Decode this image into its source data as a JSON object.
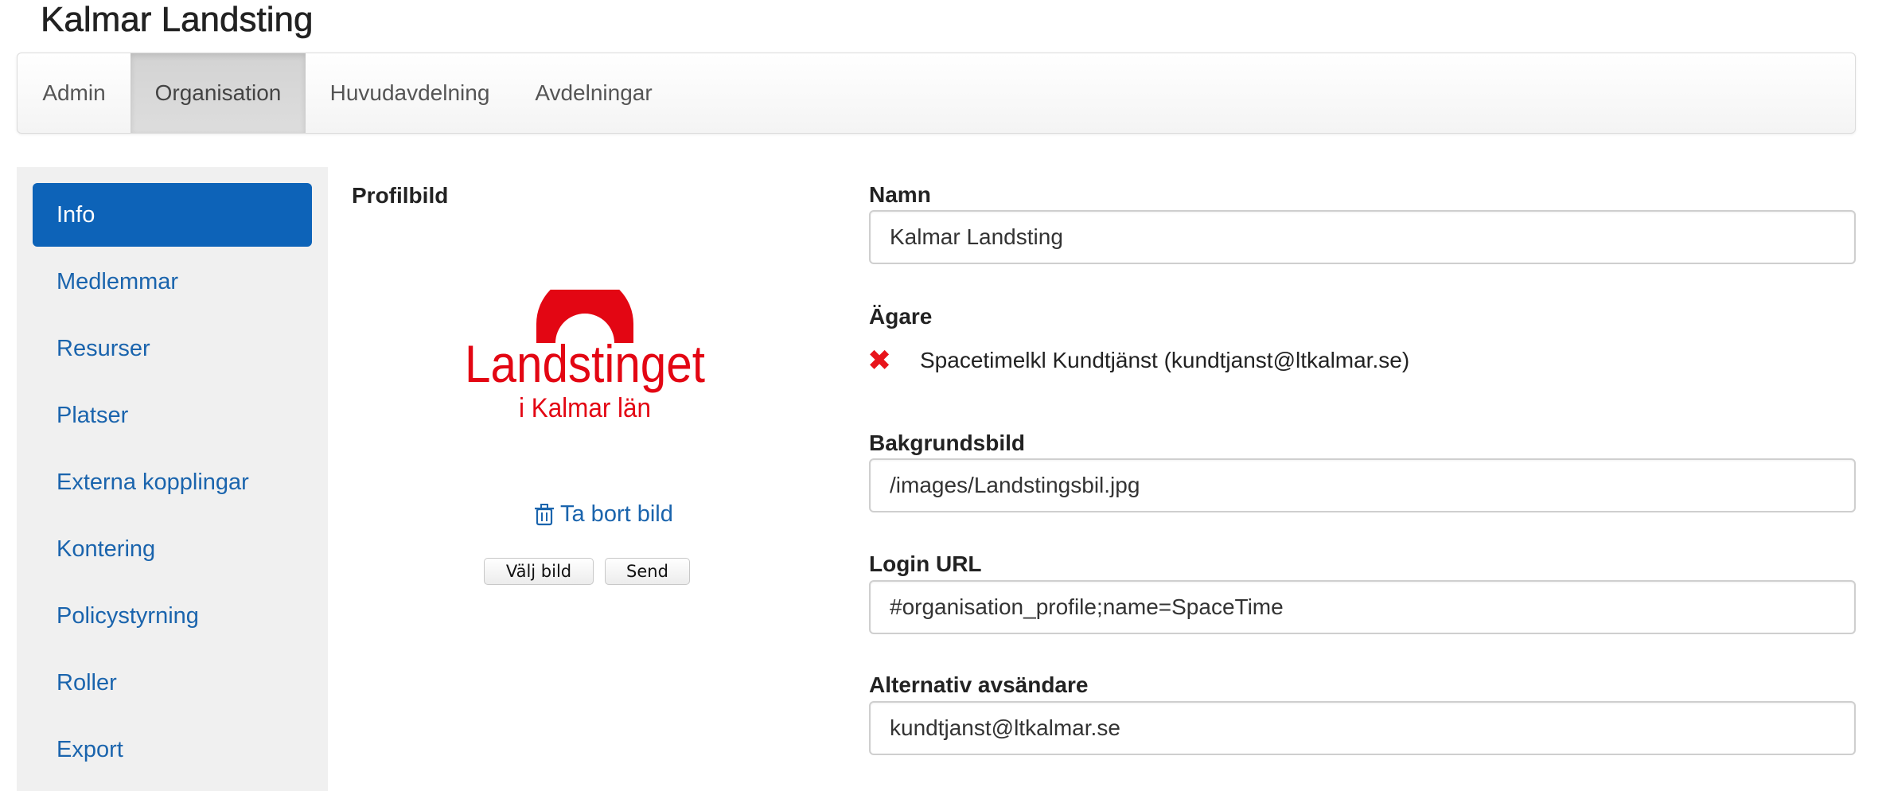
{
  "header": {
    "title": "Kalmar Landsting"
  },
  "topnav": {
    "tabs": [
      {
        "label": "Admin"
      },
      {
        "label": "Organisation",
        "active": true
      },
      {
        "label": "Huvudavdelning"
      },
      {
        "label": "Avdelningar"
      }
    ]
  },
  "sidebar": {
    "items": [
      {
        "label": "Info",
        "active": true
      },
      {
        "label": "Medlemmar"
      },
      {
        "label": "Resurser"
      },
      {
        "label": "Platser"
      },
      {
        "label": "Externa kopplingar"
      },
      {
        "label": "Kontering"
      },
      {
        "label": "Policystyrning"
      },
      {
        "label": "Roller"
      },
      {
        "label": "Export"
      }
    ]
  },
  "profile": {
    "label": "Profilbild",
    "logo_text": "Landstinget",
    "logo_subtext": "i Kalmar län",
    "remove_label": "Ta bort bild",
    "choose_label": "Välj bild",
    "send_label": "Send"
  },
  "form": {
    "name_label": "Namn",
    "name_value": "Kalmar Landsting",
    "owner_label": "Ägare",
    "owner_value": "Spacetimelkl Kundtjänst (kundtjanst@ltkalmar.se)",
    "background_label": "Bakgrundsbild",
    "background_value": "/images/Landstingsbil.jpg",
    "login_label": "Login URL",
    "login_value": "#organisation_profile;name=SpaceTime",
    "sender_label": "Alternativ avsändare",
    "sender_value": "kundtjanst@ltkalmar.se"
  },
  "colors": {
    "accent": "#0d63b8",
    "link": "#1a64ad",
    "logo_red": "#e30613",
    "remove_x": "#e8141b"
  },
  "icons": {
    "remove_owner": "x-icon",
    "remove_image": "trash-icon"
  }
}
